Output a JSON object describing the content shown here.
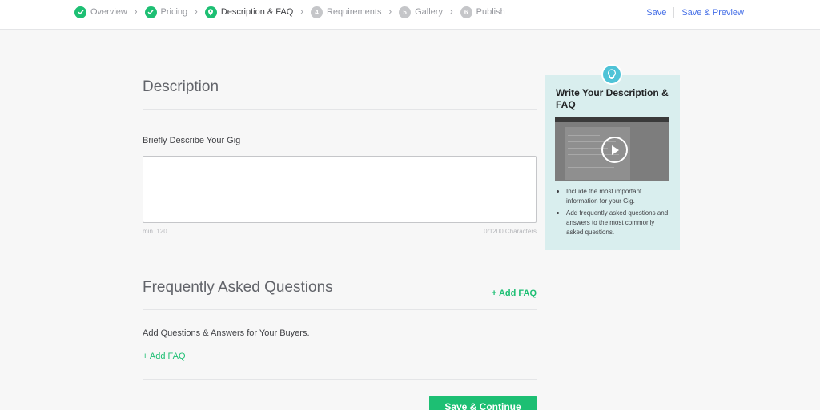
{
  "progress": {
    "steps": [
      {
        "number": "1",
        "label": "Overview",
        "state": "done"
      },
      {
        "number": "2",
        "label": "Pricing",
        "state": "done"
      },
      {
        "number": "3",
        "label": "Description & FAQ",
        "state": "current"
      },
      {
        "number": "4",
        "label": "Requirements",
        "state": "todo"
      },
      {
        "number": "5",
        "label": "Gallery",
        "state": "todo"
      },
      {
        "number": "6",
        "label": "Publish",
        "state": "todo"
      }
    ],
    "save_label": "Save",
    "save_preview_label": "Save & Preview"
  },
  "description": {
    "title": "Description",
    "field_label": "Briefly Describe Your Gig",
    "value": "",
    "min_hint": "min. 120",
    "char_count": "0/1200 Characters"
  },
  "faq": {
    "title": "Frequently Asked Questions",
    "add_faq_header": "+ Add FAQ",
    "subtitle": "Add Questions & Answers for Your Buyers.",
    "add_faq_inline": "+ Add FAQ"
  },
  "footer": {
    "save_continue_label": "Save & Continue"
  },
  "tip": {
    "title": "Write Your Description & FAQ",
    "bullets": [
      "Include the most important information for your Gig.",
      "Add frequently asked questions and answers to the most commonly asked questions."
    ],
    "icon": "lightbulb-icon"
  },
  "colors": {
    "accent": "#1dbf73",
    "link": "#446ee7",
    "tip_background": "#d9eeee"
  }
}
